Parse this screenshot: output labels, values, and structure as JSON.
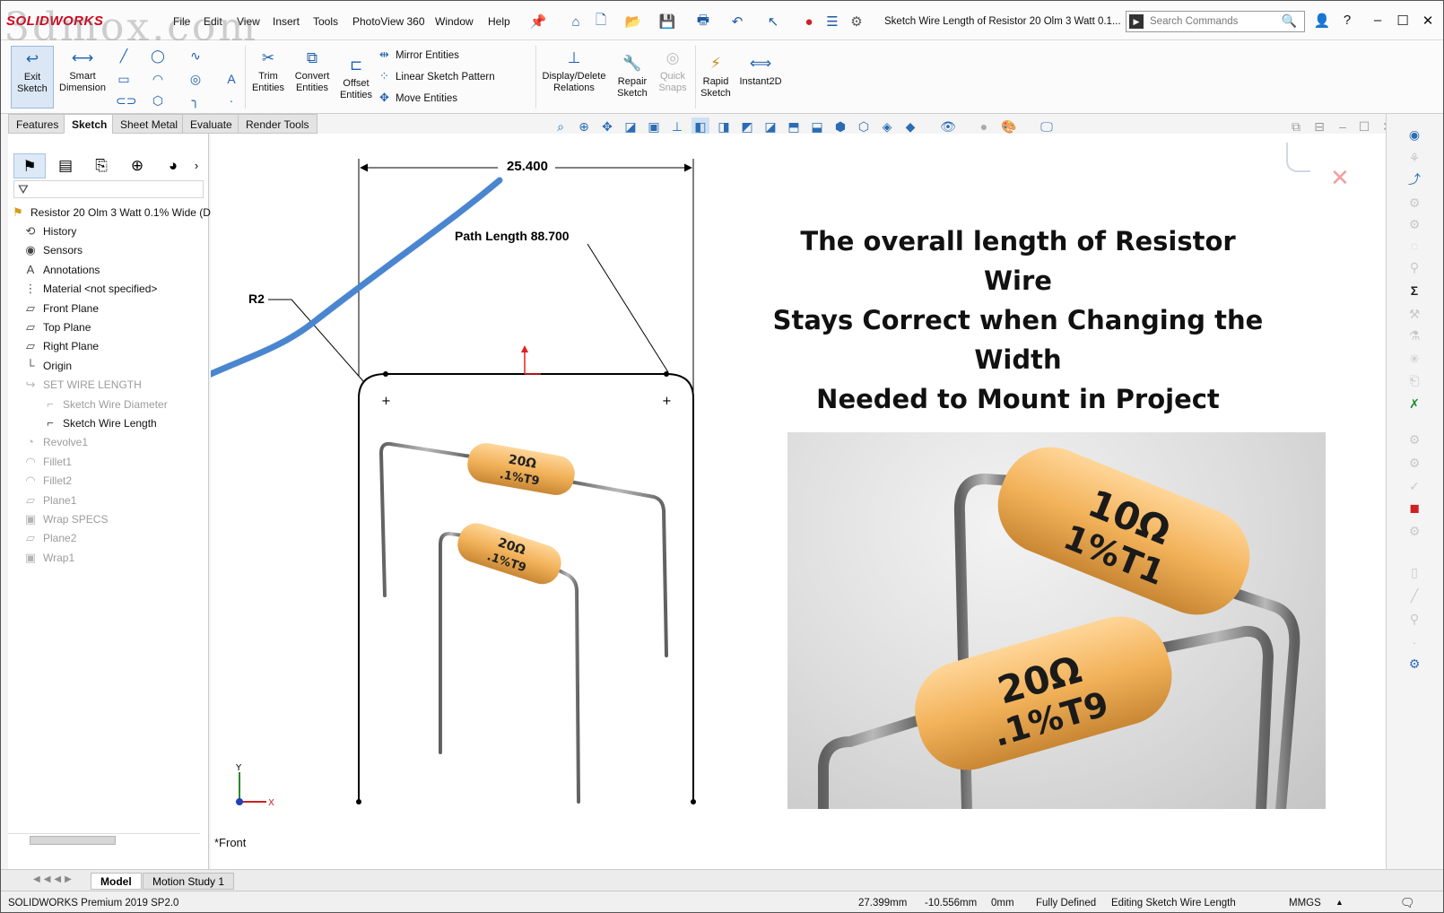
{
  "app": {
    "logo": "SOLIDWORKS",
    "window_title": "Sketch Wire Length of Resistor 20 Olm 3 Watt 0.1...",
    "watermark": "3dmox.com"
  },
  "menu": [
    "File",
    "Edit",
    "View",
    "Insert",
    "Tools",
    "PhotoView 360",
    "Window",
    "Help"
  ],
  "search": {
    "placeholder": "Search Commands"
  },
  "ribbon": {
    "exit_sketch": "Exit Sketch",
    "smart_dimension": "Smart Dimension",
    "trim_entities": "Trim Entities",
    "convert_entities": "Convert Entities",
    "offset_entities": "Offset Entities",
    "mirror_entities": "Mirror Entities",
    "linear_sketch_pattern": "Linear Sketch Pattern",
    "move_entities": "Move Entities",
    "display_delete_relations": "Display/Delete Relations",
    "repair_sketch": "Repair Sketch",
    "quick_snaps": "Quick Snaps",
    "rapid_sketch": "Rapid Sketch",
    "instant2d": "Instant2D"
  },
  "tabs": [
    {
      "label": "Features",
      "active": false
    },
    {
      "label": "Sketch",
      "active": true
    },
    {
      "label": "Sheet Metal",
      "active": false
    },
    {
      "label": "Evaluate",
      "active": false
    },
    {
      "label": "Render Tools",
      "active": false
    }
  ],
  "tree": {
    "root": "Resistor 20 Olm 3 Watt 0.1% Wide  (Def",
    "items": [
      {
        "label": "History",
        "icon": "history-icon",
        "grey": false
      },
      {
        "label": "Sensors",
        "icon": "sensors-icon",
        "grey": false
      },
      {
        "label": "Annotations",
        "icon": "annotations-icon",
        "grey": false
      },
      {
        "label": "Material <not specified>",
        "icon": "material-icon",
        "grey": false
      },
      {
        "label": "Front Plane",
        "icon": "plane-icon",
        "grey": false
      },
      {
        "label": "Top Plane",
        "icon": "plane-icon",
        "grey": false
      },
      {
        "label": "Right Plane",
        "icon": "plane-icon",
        "grey": false
      },
      {
        "label": "Origin",
        "icon": "origin-icon",
        "grey": false
      },
      {
        "label": "SET WIRE LENGTH",
        "icon": "folder-icon",
        "grey": true
      },
      {
        "label": "Sketch Wire Diameter",
        "icon": "sketch-icon",
        "grey": true
      },
      {
        "label": "Sketch Wire Length",
        "icon": "sketch-icon",
        "grey": false
      },
      {
        "label": "Revolve1",
        "icon": "revolve-icon",
        "grey": true
      },
      {
        "label": "Fillet1",
        "icon": "fillet-icon",
        "grey": true
      },
      {
        "label": "Fillet2",
        "icon": "fillet-icon",
        "grey": true
      },
      {
        "label": "Plane1",
        "icon": "plane-icon",
        "grey": true
      },
      {
        "label": "Wrap SPECS",
        "icon": "wrap-icon",
        "grey": true
      },
      {
        "label": "Plane2",
        "icon": "plane-icon",
        "grey": true
      },
      {
        "label": "Wrap1",
        "icon": "wrap-icon",
        "grey": true
      }
    ]
  },
  "sketch": {
    "dimension_width": "25.400",
    "path_length": "Path Length 88.700",
    "radius": "R2",
    "view_name": "*Front",
    "axis_x": "X",
    "axis_y": "Y"
  },
  "caption": {
    "lines": [
      "The overall length of Resistor Wire",
      "Stays Correct when Changing the Width",
      "Needed to Mount in Project"
    ]
  },
  "resistors": {
    "small_top": {
      "value": "20Ω",
      "spec": ".1%T9"
    },
    "small_bottom": {
      "value": "20Ω",
      "spec": ".1%T9"
    },
    "render_top": {
      "value": "10Ω",
      "spec": "1%T1"
    },
    "render_bottom": {
      "value": "20Ω",
      "spec": ".1%T9"
    }
  },
  "bottom_tabs": [
    {
      "label": "Model",
      "active": true
    },
    {
      "label": "Motion Study 1",
      "active": false
    }
  ],
  "status": {
    "product": "SOLIDWORKS Premium 2019 SP2.0",
    "x_coord": "27.399mm",
    "y_coord": "-10.556mm",
    "z_coord": "0mm",
    "state": "Fully Defined",
    "editing": "Editing Sketch Wire Length",
    "units": "MMGS"
  },
  "colors": {
    "resistor_body": "#f2b25a",
    "wire": "#7d7d7d",
    "annotation_arrow": "#4a86d0",
    "sketch_line": "#000000"
  }
}
